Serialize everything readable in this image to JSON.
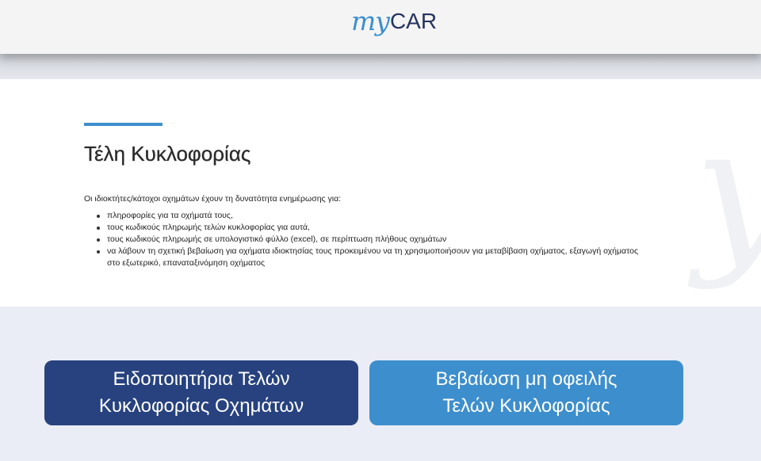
{
  "header": {
    "logo_prefix": "my",
    "logo_suffix": "CAR"
  },
  "main": {
    "title": "Τέλη Κυκλοφορίας",
    "intro": "Οι ιδιοκτήτες/κάτοχοι οχημάτων έχουν τη δυνατότητα ενημέρωσης για:",
    "bullets": [
      "πληροφορίες για τα οχήματά τους,",
      "τους κωδικούς πληρωμής τελών κυκλοφορίας για αυτά,",
      "τους κωδικούς πληρωμής σε υπολογιστικό φύλλο (excel), σε περίπτωση πλήθους οχημάτων",
      "να λάβουν τη σχετική βεβαίωση για οχήματα ιδιοκτησίας τους προκειμένου να τη χρησιμοποιήσουν για μεταβίβαση οχήματος, εξαγωγή οχήματος στο εξωτερικό, επαναταξινόμηση οχήματος"
    ]
  },
  "actions": {
    "notices_button": "Ειδοποιητήρια Τελών\nΚυκλοφορίας Οχημάτων",
    "certificate_button": "Βεβαίωση μη οφειλής\nΤελών Κυκλοφορίας"
  },
  "colors": {
    "primary_dark": "#27427f",
    "primary_light": "#3d8ecd",
    "logo_blue": "#3a8fd0",
    "logo_navy": "#26345e"
  }
}
